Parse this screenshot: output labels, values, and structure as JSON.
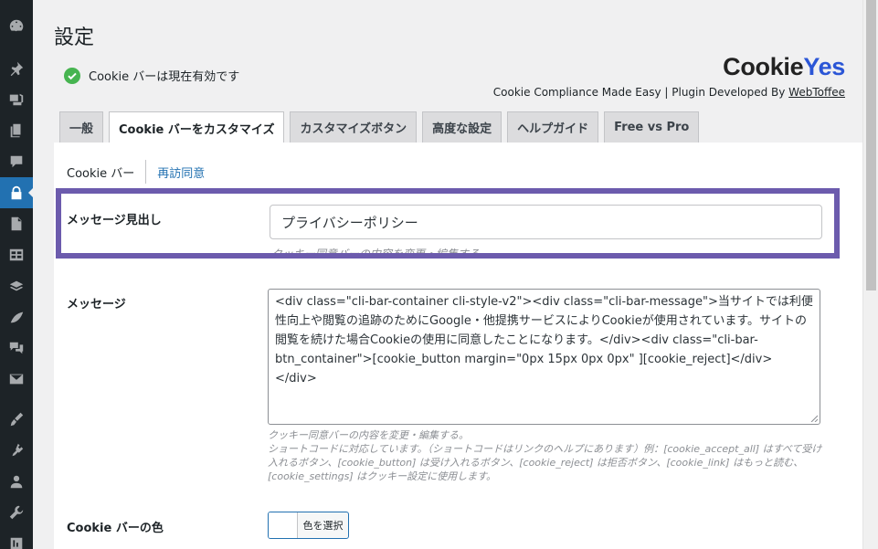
{
  "page": {
    "title": "設定"
  },
  "status": {
    "text": "Cookie バーは現在有効です"
  },
  "brand": {
    "logo_part1": "Cookie",
    "logo_part2": "Yes",
    "tagline_prefix": "Cookie Compliance Made Easy | Plugin Developed By ",
    "tagline_link": "WebToffee"
  },
  "tabs": [
    {
      "label": "一般"
    },
    {
      "label": "Cookie バーをカスタマイズ"
    },
    {
      "label": "カスタマイズボタン"
    },
    {
      "label": "高度な設定"
    },
    {
      "label": "ヘルプガイド"
    },
    {
      "label": "Free vs Pro"
    }
  ],
  "subtabs": [
    {
      "label": "Cookie バー"
    },
    {
      "label": "再訪同意"
    }
  ],
  "fields": {
    "heading": {
      "label": "メッセージ見出し",
      "value": "プライバシーポリシー"
    },
    "message": {
      "label": "メッセージ",
      "value": "<div class=\"cli-bar-container cli-style-v2\"><div class=\"cli-bar-message\">当サイトでは利便性向上や閲覧の追跡のためにGoogle・他提携サービスによりCookieが使用されています。サイトの閲覧を続けた場合Cookieの使用に同意したことになります。</div><div class=\"cli-bar-btn_container\">[cookie_button margin=\"0px 15px 0px 0px\" ][cookie_reject]</div></div>",
      "desc_line1": "クッキー同意バーの内容を変更・編集する。",
      "desc_line2": "ショートコードに対応しています。（ショートコードはリンクのヘルプにあります）例：[cookie_accept_all] はすべて受け入れるボタン、[cookie_button] は受け入れるボタン、[cookie_reject] は拒否ボタン、[cookie_link] はもっと読む、[cookie_settings] はクッキー設定に使用します。"
    },
    "bar_color": {
      "label": "Cookie バーの色",
      "button_label": "色を選択"
    }
  },
  "colors": {
    "accent": "#2271b1",
    "highlight": "#6c5bad",
    "success": "#46b450"
  }
}
